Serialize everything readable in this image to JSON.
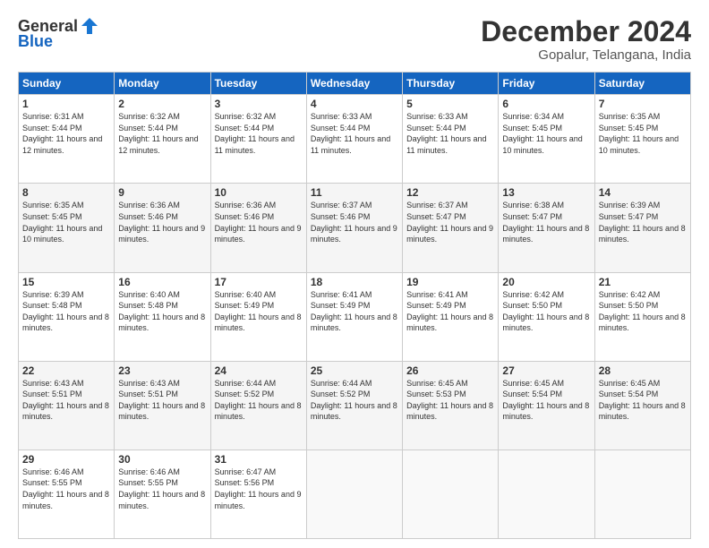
{
  "logo": {
    "general": "General",
    "blue": "Blue"
  },
  "header": {
    "month": "December 2024",
    "location": "Gopalur, Telangana, India"
  },
  "days_of_week": [
    "Sunday",
    "Monday",
    "Tuesday",
    "Wednesday",
    "Thursday",
    "Friday",
    "Saturday"
  ],
  "weeks": [
    [
      {
        "day": "1",
        "sunrise": "6:31 AM",
        "sunset": "5:44 PM",
        "daylight": "11 hours and 12 minutes."
      },
      {
        "day": "2",
        "sunrise": "6:32 AM",
        "sunset": "5:44 PM",
        "daylight": "11 hours and 12 minutes."
      },
      {
        "day": "3",
        "sunrise": "6:32 AM",
        "sunset": "5:44 PM",
        "daylight": "11 hours and 11 minutes."
      },
      {
        "day": "4",
        "sunrise": "6:33 AM",
        "sunset": "5:44 PM",
        "daylight": "11 hours and 11 minutes."
      },
      {
        "day": "5",
        "sunrise": "6:33 AM",
        "sunset": "5:44 PM",
        "daylight": "11 hours and 11 minutes."
      },
      {
        "day": "6",
        "sunrise": "6:34 AM",
        "sunset": "5:45 PM",
        "daylight": "11 hours and 10 minutes."
      },
      {
        "day": "7",
        "sunrise": "6:35 AM",
        "sunset": "5:45 PM",
        "daylight": "11 hours and 10 minutes."
      }
    ],
    [
      {
        "day": "8",
        "sunrise": "6:35 AM",
        "sunset": "5:45 PM",
        "daylight": "11 hours and 10 minutes."
      },
      {
        "day": "9",
        "sunrise": "6:36 AM",
        "sunset": "5:46 PM",
        "daylight": "11 hours and 9 minutes."
      },
      {
        "day": "10",
        "sunrise": "6:36 AM",
        "sunset": "5:46 PM",
        "daylight": "11 hours and 9 minutes."
      },
      {
        "day": "11",
        "sunrise": "6:37 AM",
        "sunset": "5:46 PM",
        "daylight": "11 hours and 9 minutes."
      },
      {
        "day": "12",
        "sunrise": "6:37 AM",
        "sunset": "5:47 PM",
        "daylight": "11 hours and 9 minutes."
      },
      {
        "day": "13",
        "sunrise": "6:38 AM",
        "sunset": "5:47 PM",
        "daylight": "11 hours and 8 minutes."
      },
      {
        "day": "14",
        "sunrise": "6:39 AM",
        "sunset": "5:47 PM",
        "daylight": "11 hours and 8 minutes."
      }
    ],
    [
      {
        "day": "15",
        "sunrise": "6:39 AM",
        "sunset": "5:48 PM",
        "daylight": "11 hours and 8 minutes."
      },
      {
        "day": "16",
        "sunrise": "6:40 AM",
        "sunset": "5:48 PM",
        "daylight": "11 hours and 8 minutes."
      },
      {
        "day": "17",
        "sunrise": "6:40 AM",
        "sunset": "5:49 PM",
        "daylight": "11 hours and 8 minutes."
      },
      {
        "day": "18",
        "sunrise": "6:41 AM",
        "sunset": "5:49 PM",
        "daylight": "11 hours and 8 minutes."
      },
      {
        "day": "19",
        "sunrise": "6:41 AM",
        "sunset": "5:49 PM",
        "daylight": "11 hours and 8 minutes."
      },
      {
        "day": "20",
        "sunrise": "6:42 AM",
        "sunset": "5:50 PM",
        "daylight": "11 hours and 8 minutes."
      },
      {
        "day": "21",
        "sunrise": "6:42 AM",
        "sunset": "5:50 PM",
        "daylight": "11 hours and 8 minutes."
      }
    ],
    [
      {
        "day": "22",
        "sunrise": "6:43 AM",
        "sunset": "5:51 PM",
        "daylight": "11 hours and 8 minutes."
      },
      {
        "day": "23",
        "sunrise": "6:43 AM",
        "sunset": "5:51 PM",
        "daylight": "11 hours and 8 minutes."
      },
      {
        "day": "24",
        "sunrise": "6:44 AM",
        "sunset": "5:52 PM",
        "daylight": "11 hours and 8 minutes."
      },
      {
        "day": "25",
        "sunrise": "6:44 AM",
        "sunset": "5:52 PM",
        "daylight": "11 hours and 8 minutes."
      },
      {
        "day": "26",
        "sunrise": "6:45 AM",
        "sunset": "5:53 PM",
        "daylight": "11 hours and 8 minutes."
      },
      {
        "day": "27",
        "sunrise": "6:45 AM",
        "sunset": "5:54 PM",
        "daylight": "11 hours and 8 minutes."
      },
      {
        "day": "28",
        "sunrise": "6:45 AM",
        "sunset": "5:54 PM",
        "daylight": "11 hours and 8 minutes."
      }
    ],
    [
      {
        "day": "29",
        "sunrise": "6:46 AM",
        "sunset": "5:55 PM",
        "daylight": "11 hours and 8 minutes."
      },
      {
        "day": "30",
        "sunrise": "6:46 AM",
        "sunset": "5:55 PM",
        "daylight": "11 hours and 8 minutes."
      },
      {
        "day": "31",
        "sunrise": "6:47 AM",
        "sunset": "5:56 PM",
        "daylight": "11 hours and 9 minutes."
      },
      null,
      null,
      null,
      null
    ]
  ]
}
